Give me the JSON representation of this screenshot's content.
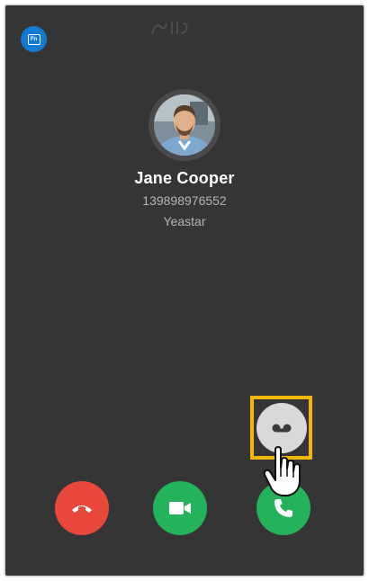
{
  "caller": {
    "name": "Jane Cooper",
    "number": "139898976552",
    "company": "Yeastar"
  },
  "icons": {
    "top_logo": "app-logo-icon",
    "voicemail": "voicemail-icon",
    "hangup": "phone-hangup-icon",
    "video": "video-camera-icon",
    "answer": "phone-answer-icon",
    "cursor": "hand-pointer-icon"
  },
  "colors": {
    "background": "#353535",
    "hangup": "#e9483a",
    "video": "#24b35a",
    "answer": "#24b35a",
    "voicemail": "#d9d9d9",
    "highlight": "#f2b705",
    "logo": "#1479d1"
  }
}
